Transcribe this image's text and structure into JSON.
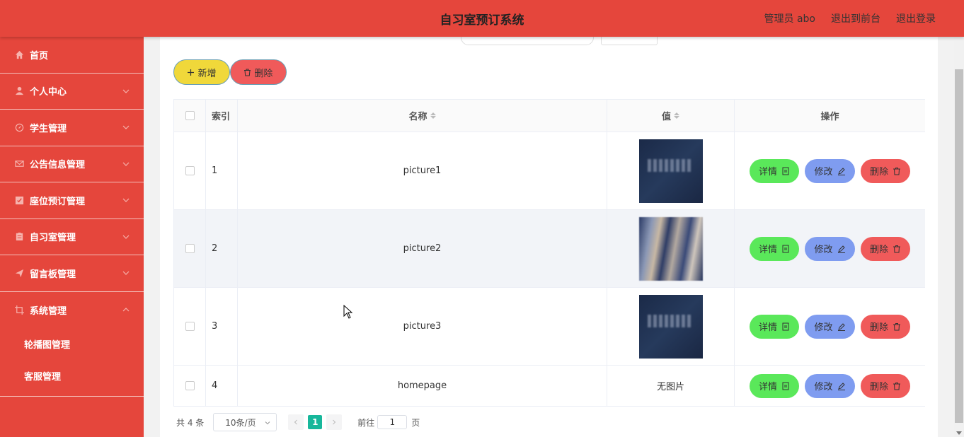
{
  "header": {
    "title": "自习室预订系统",
    "links": [
      "管理员 abo",
      "退出到前台",
      "退出登录"
    ]
  },
  "sidebar": {
    "items": [
      {
        "label": "首页",
        "icon": "home-icon"
      },
      {
        "label": "个人中心",
        "icon": "user-icon"
      },
      {
        "label": "学生管理",
        "icon": "compass-icon"
      },
      {
        "label": "公告信息管理",
        "icon": "mail-icon"
      },
      {
        "label": "座位预订管理",
        "icon": "checkbox-icon"
      },
      {
        "label": "自习室管理",
        "icon": "clipboard-icon"
      },
      {
        "label": "留言板管理",
        "icon": "send-icon"
      },
      {
        "label": "系统管理",
        "icon": "crop-icon"
      }
    ],
    "subitems": [
      "轮播图管理",
      "客服管理"
    ]
  },
  "toolbar": {
    "add_label": "新增",
    "delete_label": "删除"
  },
  "table": {
    "headers": {
      "index": "索引",
      "name": "名称",
      "value": "值",
      "actions": "操作"
    },
    "rows": [
      {
        "index": "1",
        "name": "picture1",
        "value": "",
        "image": "thumb-dark-text"
      },
      {
        "index": "2",
        "name": "picture2",
        "value": "",
        "image": "thumb-buildings"
      },
      {
        "index": "3",
        "name": "picture3",
        "value": "",
        "image": "thumb-dark-text"
      },
      {
        "index": "4",
        "name": "homepage",
        "value": "无图片",
        "image": ""
      }
    ],
    "actions": {
      "detail": "详情",
      "edit": "修改",
      "delete": "删除"
    }
  },
  "pagination": {
    "total": "共 4 条",
    "page_size": "10条/页",
    "current_page": "1",
    "goto_prefix": "前往",
    "goto_value": "1",
    "goto_suffix": "页"
  },
  "colors": {
    "header_bg": "#e5463c",
    "sidebar_bg": "#e5463c",
    "add_btn": "#f0d83a",
    "delete_btn": "#f05a5a",
    "detail_btn": "#5ae85a",
    "edit_btn": "#7f9cf0",
    "page_active": "#17b79b"
  }
}
